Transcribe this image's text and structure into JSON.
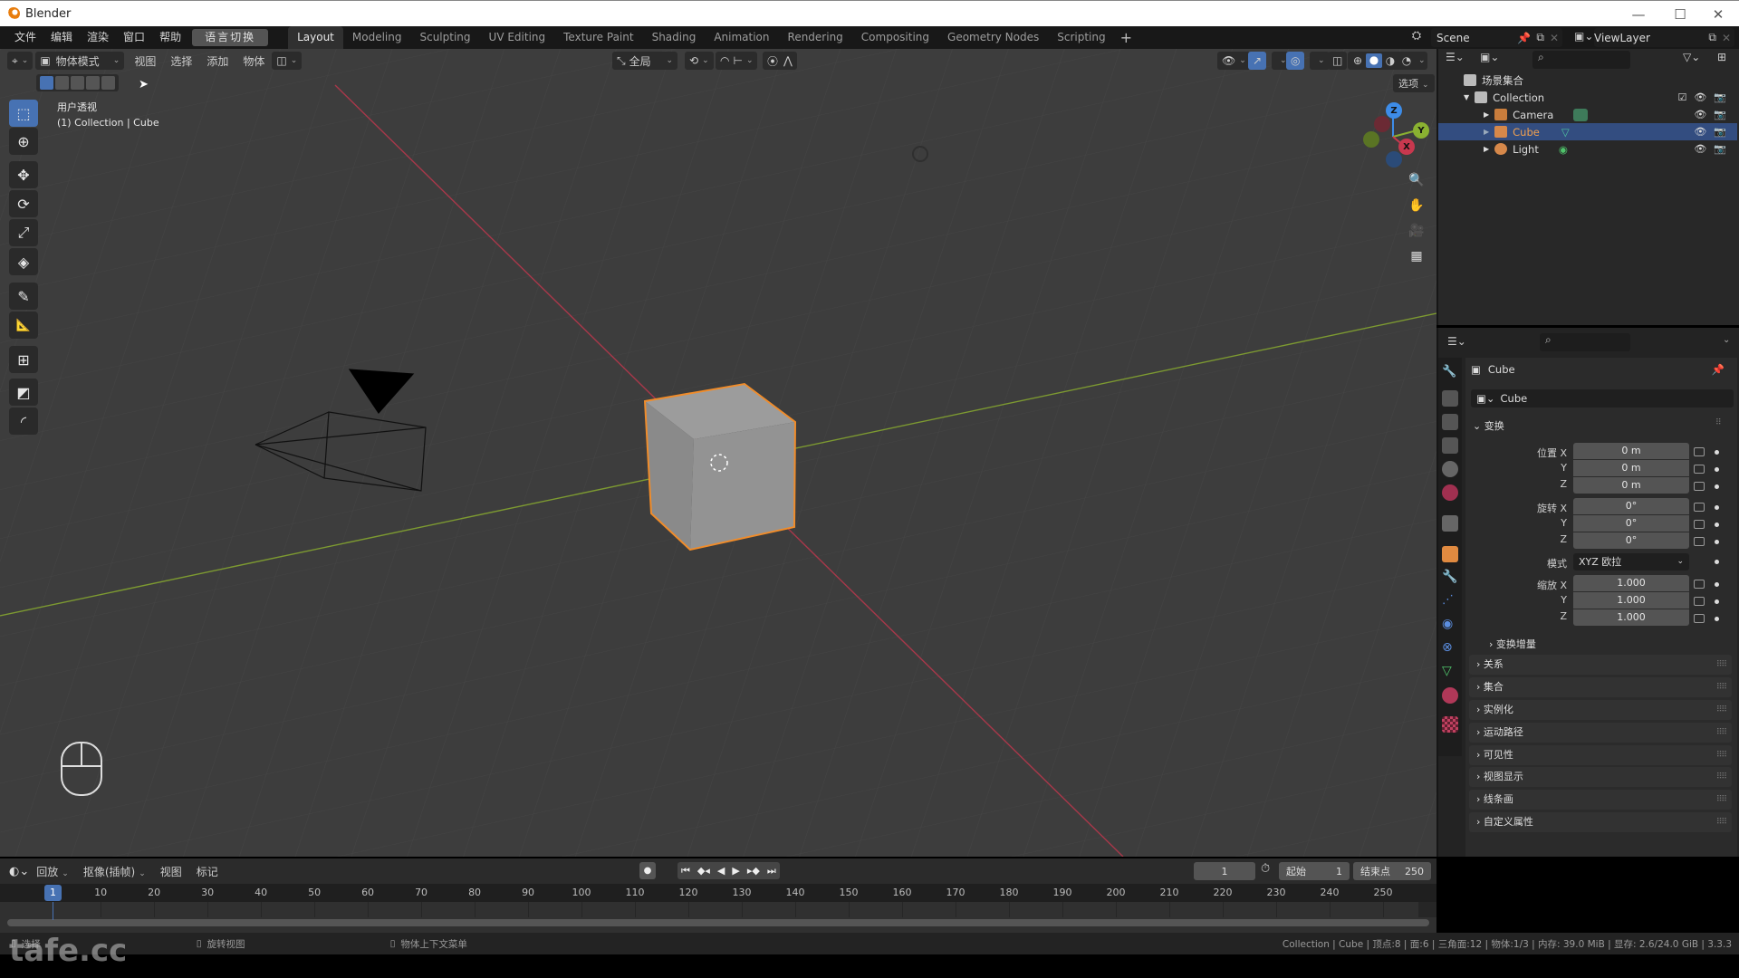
{
  "window": {
    "title": "Blender",
    "minimize": "—",
    "maximize": "☐",
    "close": "✕"
  },
  "menubar": {
    "menus": [
      "文件",
      "编辑",
      "渲染",
      "窗口",
      "帮助"
    ],
    "language_button": "语言切换",
    "workspaces": [
      "Layout",
      "Modeling",
      "Sculpting",
      "UV Editing",
      "Texture Paint",
      "Shading",
      "Animation",
      "Rendering",
      "Compositing",
      "Geometry Nodes",
      "Scripting"
    ],
    "active_workspace": "Layout",
    "add_workspace": "+",
    "scene": "Scene",
    "view_layer": "ViewLayer"
  },
  "viewport_header": {
    "mode": "物体模式",
    "menus": [
      "视图",
      "选择",
      "添加",
      "物体"
    ],
    "transform_orientation": "全局",
    "options_label": "选项"
  },
  "viewport": {
    "view_name": "用户透视",
    "context": "(1) Collection | Cube",
    "gizmo_axes": [
      "X",
      "Y",
      "Z"
    ],
    "colors": {
      "x_axis": "#c8384e",
      "y_axis": "#8ab131",
      "z_axis": "#3d8ce8",
      "selection": "#f08c2a",
      "background": "#3d3d3d"
    }
  },
  "toolbar": {
    "tools": [
      {
        "name": "select-box",
        "icon": "⬚",
        "active": true
      },
      {
        "name": "cursor",
        "icon": "⊕",
        "active": false
      },
      {
        "name": "move",
        "icon": "✥",
        "active": false
      },
      {
        "name": "rotate",
        "icon": "⟳",
        "active": false
      },
      {
        "name": "scale",
        "icon": "⤢",
        "active": false
      },
      {
        "name": "transform",
        "icon": "◈",
        "active": false
      },
      {
        "name": "annotate",
        "icon": "✎",
        "active": false
      },
      {
        "name": "measure",
        "icon": "📐",
        "active": false
      },
      {
        "name": "add-cube",
        "icon": "⊞",
        "active": false
      },
      {
        "name": "extrude",
        "icon": "◩",
        "active": false
      },
      {
        "name": "bevel",
        "icon": "◜",
        "active": false
      }
    ]
  },
  "outliner": {
    "search_placeholder": "",
    "root": "场景集合",
    "collection": "Collection",
    "items": [
      {
        "name": "Camera",
        "selected": false
      },
      {
        "name": "Cube",
        "selected": true
      },
      {
        "name": "Light",
        "selected": false
      }
    ]
  },
  "properties": {
    "object_name": "Cube",
    "datablock_name": "Cube",
    "transform_panel": "变换",
    "location_label": "位置 X",
    "rotation_label": "旋转 X",
    "mode_label": "模式",
    "scale_label": "缩放 X",
    "axis_y": "Y",
    "axis_z": "Z",
    "location": [
      "0 m",
      "0 m",
      "0 m"
    ],
    "rotation": [
      "0°",
      "0°",
      "0°"
    ],
    "rotation_mode": "XYZ 欧拉",
    "scale": [
      "1.000",
      "1.000",
      "1.000"
    ],
    "delta_transform": "变换增量",
    "panels": [
      "关系",
      "集合",
      "实例化",
      "运动路径",
      "可见性",
      "视图显示",
      "线条画",
      "自定义属性"
    ]
  },
  "timeline": {
    "menus": [
      "回放",
      "抠像(插帧)",
      "视图",
      "标记"
    ],
    "current_frame": "1",
    "start_label": "起始",
    "start": "1",
    "end_label": "结束点",
    "end": "250",
    "ruler": [
      "1",
      "10",
      "20",
      "30",
      "40",
      "50",
      "60",
      "70",
      "80",
      "90",
      "100",
      "110",
      "120",
      "130",
      "140",
      "150",
      "160",
      "170",
      "180",
      "190",
      "200",
      "210",
      "220",
      "230",
      "240",
      "250"
    ]
  },
  "statusbar": {
    "left_hint": "选择",
    "middle_hint": "旋转视图",
    "right_hint": "物体上下文菜单",
    "stats": "Collection | Cube | 顶点:8 | 面:6 | 三角面:12 | 物体:1/3 | 内存: 39.0 MiB | 显存: 2.6/24.0 GiB | 3.3.3"
  },
  "watermark": "tafe.cc"
}
